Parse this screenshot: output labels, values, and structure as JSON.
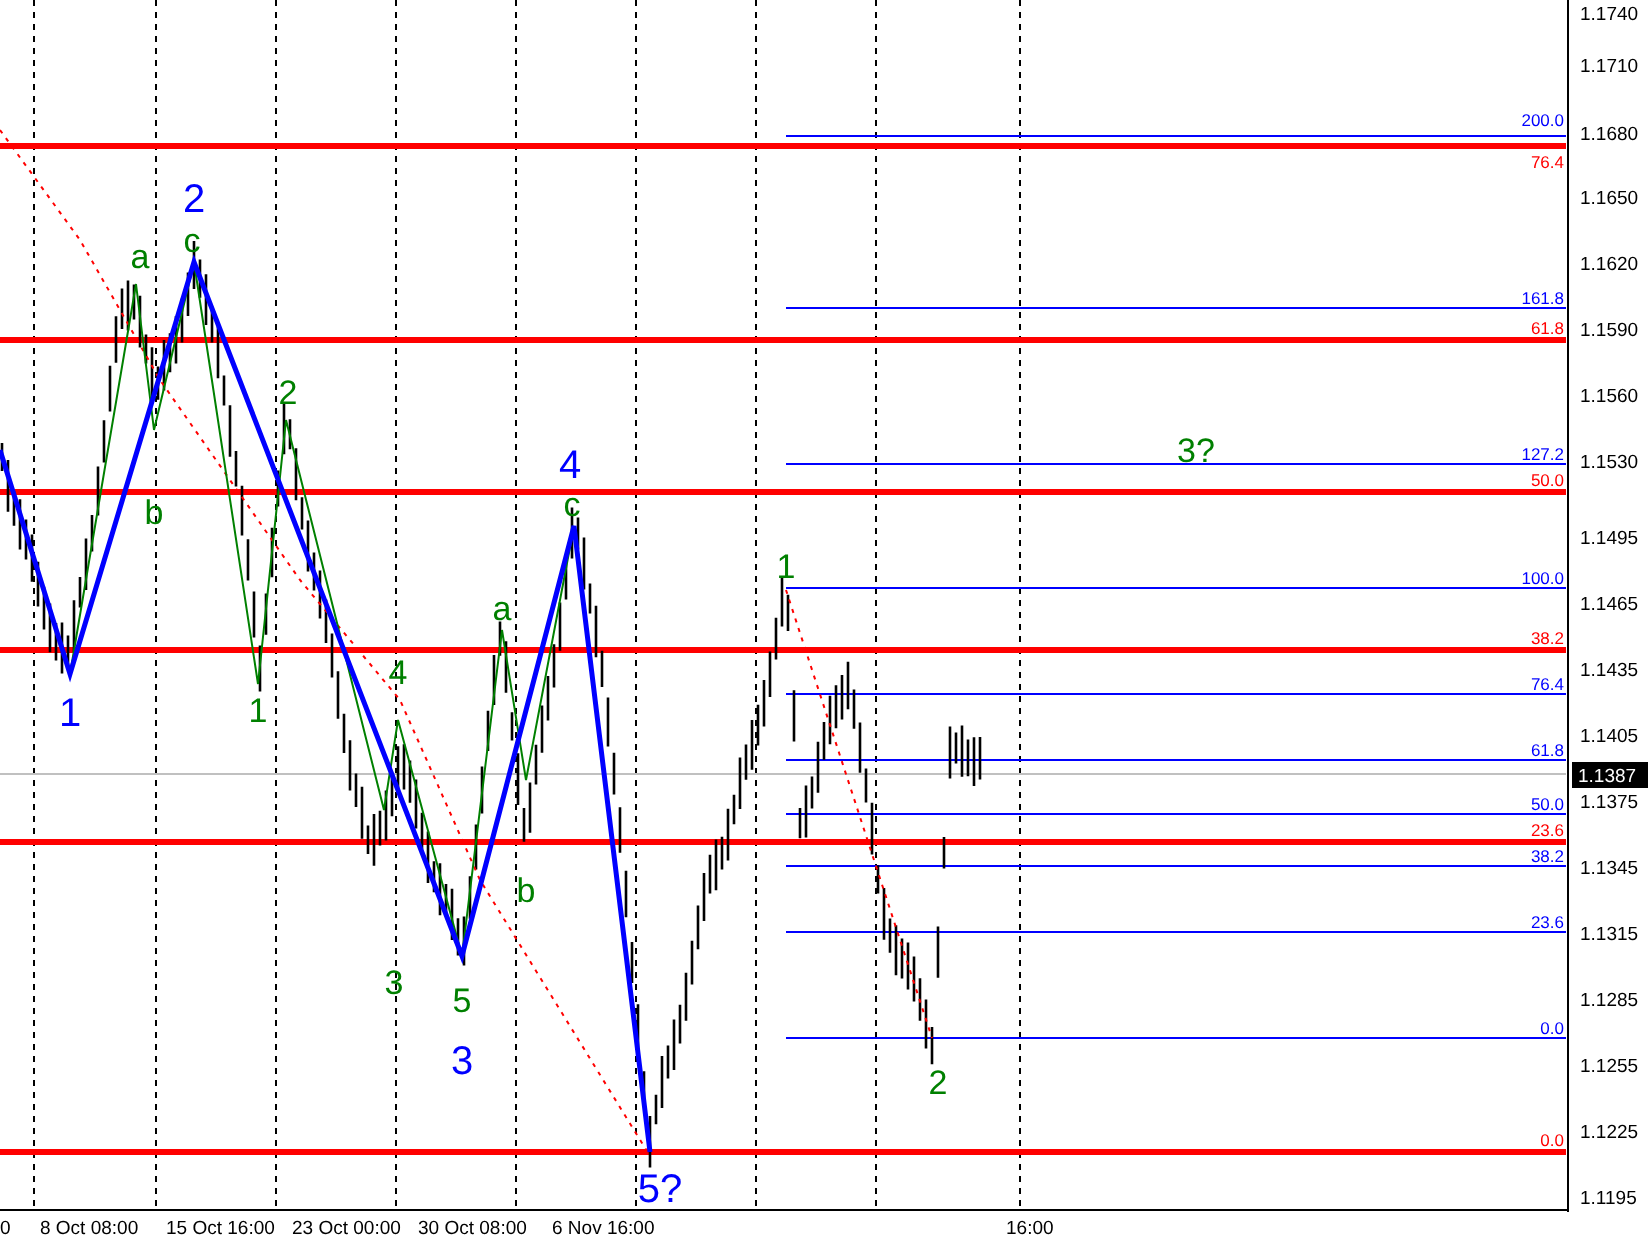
{
  "chart": {
    "price_axis": [
      "1.1740",
      "1.1710",
      "1.1680",
      "1.1650",
      "1.1620",
      "1.1590",
      "1.1560",
      "1.1530",
      "1.1495",
      "1.1465",
      "1.1435",
      "1.1405",
      "1.1375",
      "1.1345",
      "1.1315",
      "1.1285",
      "1.1255",
      "1.1225",
      "1.1195"
    ],
    "current_price": "1.1387",
    "time_axis": [
      "0",
      "8 Oct 08:00",
      "15 Oct 16:00",
      "23 Oct 00:00",
      "30 Oct 08:00",
      "6 Nov 16:00",
      "16:00"
    ],
    "retracement_levels": [
      {
        "label": "76.4"
      },
      {
        "label": "61.8"
      },
      {
        "label": "50.0"
      },
      {
        "label": "38.2"
      },
      {
        "label": "23.6"
      },
      {
        "label": "0.0"
      }
    ],
    "extension_levels": [
      {
        "label": "200.0"
      },
      {
        "label": "161.8"
      },
      {
        "label": "127.2"
      },
      {
        "label": "100.0"
      },
      {
        "label": "76.4"
      },
      {
        "label": "61.8"
      },
      {
        "label": "50.0"
      },
      {
        "label": "38.2"
      },
      {
        "label": "23.6"
      },
      {
        "label": "0.0"
      }
    ],
    "wave_labels": [
      {
        "text": "2",
        "color": "#0000ff"
      },
      {
        "text": "1",
        "color": "#0000ff"
      },
      {
        "text": "4",
        "color": "#0000ff"
      },
      {
        "text": "3",
        "color": "#0000ff"
      },
      {
        "text": "5?",
        "color": "#0000ff"
      },
      {
        "text": "a",
        "color": "#008000"
      },
      {
        "text": "c",
        "color": "#008000"
      },
      {
        "text": "b",
        "color": "#008000"
      },
      {
        "text": "2",
        "color": "#008000"
      },
      {
        "text": "1",
        "color": "#008000"
      },
      {
        "text": "4",
        "color": "#008000"
      },
      {
        "text": "3",
        "color": "#008000"
      },
      {
        "text": "5",
        "color": "#008000"
      },
      {
        "text": "a",
        "color": "#008000"
      },
      {
        "text": "c",
        "color": "#008000"
      },
      {
        "text": "b",
        "color": "#008000"
      },
      {
        "text": "1",
        "color": "#008000"
      },
      {
        "text": "2",
        "color": "#008000"
      },
      {
        "text": "3?",
        "color": "#008000"
      }
    ]
  }
}
